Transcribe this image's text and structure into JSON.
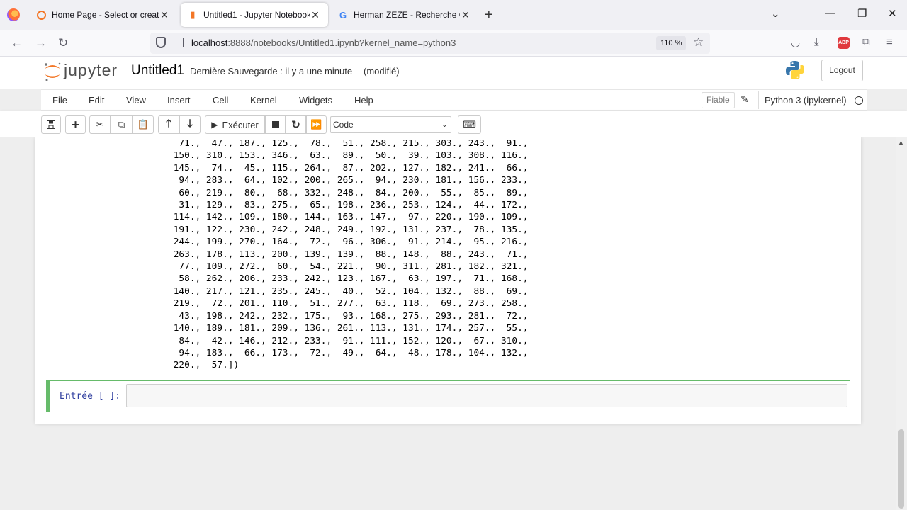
{
  "browser": {
    "tabs": [
      {
        "title": "Home Page - Select or create a",
        "icon": "jupyter-home-icon",
        "active": false
      },
      {
        "title": "Untitled1 - Jupyter Notebook",
        "icon": "jupyter-notebook-icon",
        "active": true
      },
      {
        "title": "Herman ZEZE - Recherche Goog",
        "icon": "google-icon",
        "active": false
      }
    ],
    "url_host": "localhost",
    "url_rest": ":8888/notebooks/Untitled1.ipynb?kernel_name=python3",
    "zoom": "110 %",
    "abp_label": "ABP"
  },
  "jupyter": {
    "logo_text": "jupyter",
    "notebook_name": "Untitled1",
    "checkpoint": "Dernière Sauvegarde : il y a une minute",
    "modified": "(modifié)",
    "logout": "Logout",
    "menu": [
      "File",
      "Edit",
      "View",
      "Insert",
      "Cell",
      "Kernel",
      "Widgets",
      "Help"
    ],
    "trusted": "Fiable",
    "kernel": "Python 3 (ipykernel)",
    "toolbar": {
      "run_label": "Exécuter",
      "cell_type": "Code"
    },
    "output_lines": [
      "  71.,  47., 187., 125.,  78.,  51., 258., 215., 303., 243.,  91.,",
      " 150., 310., 153., 346.,  63.,  89.,  50.,  39., 103., 308., 116.,",
      " 145.,  74.,  45., 115., 264.,  87., 202., 127., 182., 241.,  66.,",
      "  94., 283.,  64., 102., 200., 265.,  94., 230., 181., 156., 233.,",
      "  60., 219.,  80.,  68., 332., 248.,  84., 200.,  55.,  85.,  89.,",
      "  31., 129.,  83., 275.,  65., 198., 236., 253., 124.,  44., 172.,",
      " 114., 142., 109., 180., 144., 163., 147.,  97., 220., 190., 109.,",
      " 191., 122., 230., 242., 248., 249., 192., 131., 237.,  78., 135.,",
      " 244., 199., 270., 164.,  72.,  96., 306.,  91., 214.,  95., 216.,",
      " 263., 178., 113., 200., 139., 139.,  88., 148.,  88., 243.,  71.,",
      "  77., 109., 272.,  60.,  54., 221.,  90., 311., 281., 182., 321.,",
      "  58., 262., 206., 233., 242., 123., 167.,  63., 197.,  71., 168.,",
      " 140., 217., 121., 235., 245.,  40.,  52., 104., 132.,  88.,  69.,",
      " 219.,  72., 201., 110.,  51., 277.,  63., 118.,  69., 273., 258.,",
      "  43., 198., 242., 232., 175.,  93., 168., 275., 293., 281.,  72.,",
      " 140., 189., 181., 209., 136., 261., 113., 131., 174., 257.,  55.,",
      "  84.,  42., 146., 212., 233.,  91., 111., 152., 120.,  67., 310.,",
      "  94., 183.,  66., 173.,  72.,  49.,  64.,  48., 178., 104., 132.,",
      " 220.,  57.])"
    ],
    "input_prompt": "Entrée [ ]:",
    "input_value": ""
  }
}
